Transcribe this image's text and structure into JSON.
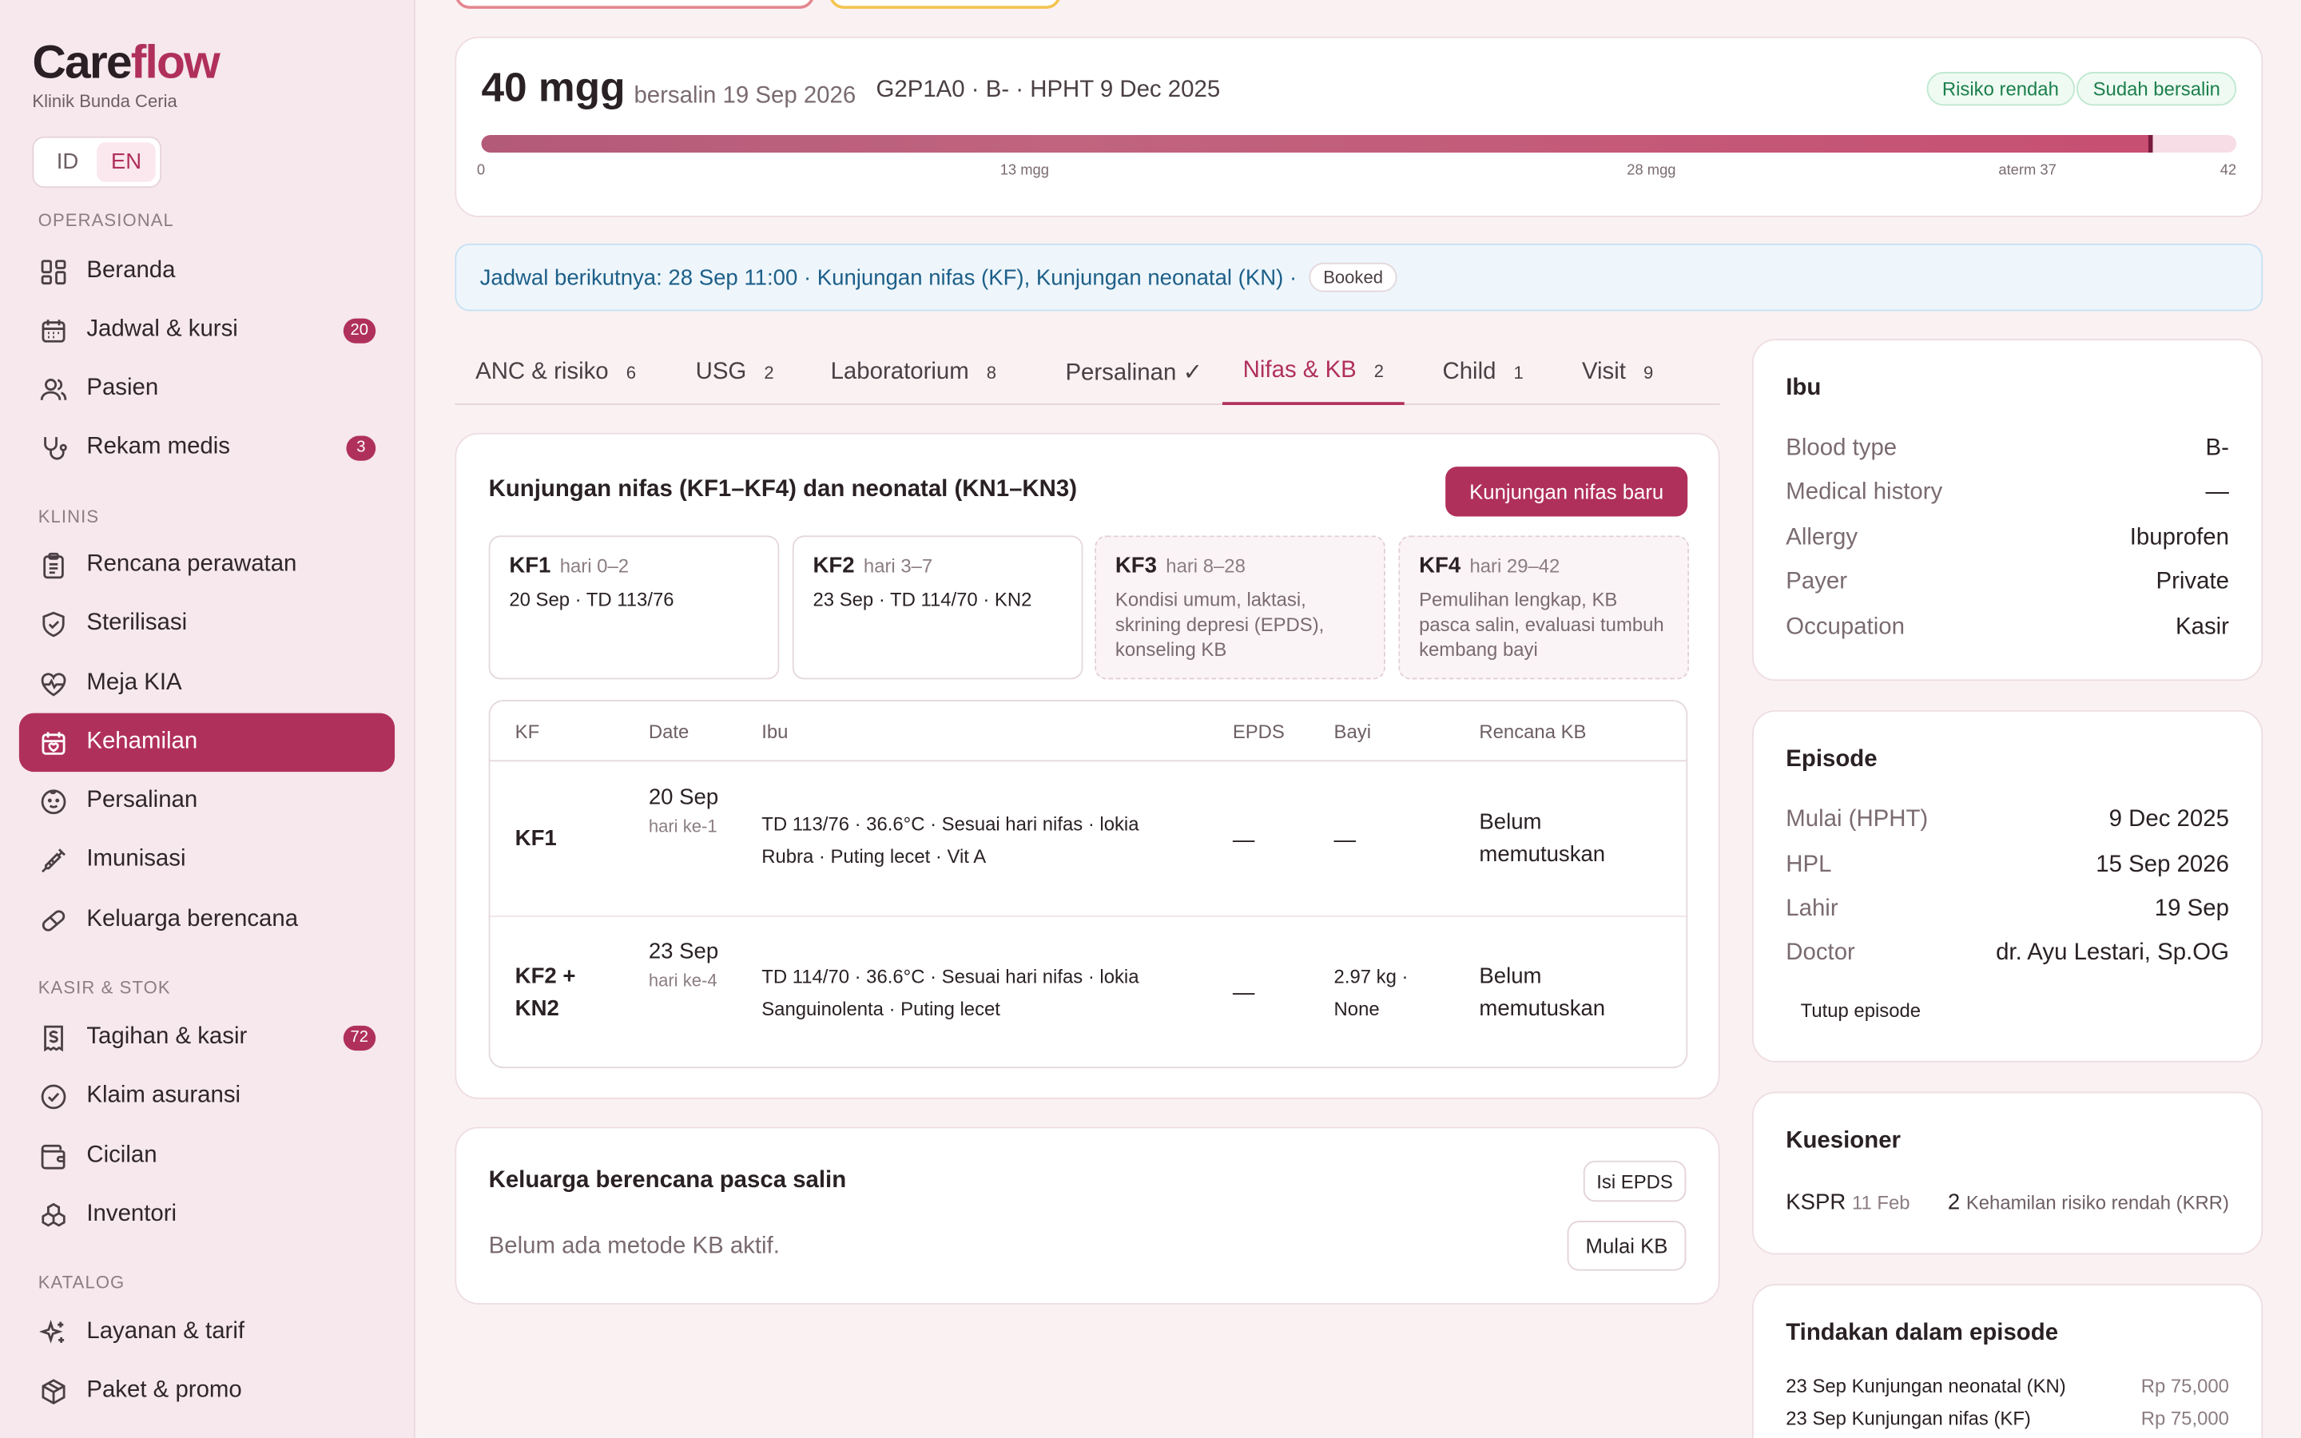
{
  "brand": {
    "name_main": "Care",
    "name_accent": "flow",
    "clinic": "Klinik Bunda Ceria"
  },
  "lang": {
    "id": "ID",
    "en": "EN"
  },
  "sidebar": {
    "sections": [
      {
        "label": "OPERASIONAL"
      },
      {
        "label": "KLINIS"
      },
      {
        "label": "KASIR & STOK"
      },
      {
        "label": "KATALOG"
      }
    ],
    "items": [
      {
        "label": "Beranda",
        "icon": "grid-icon"
      },
      {
        "label": "Jadwal & kursi",
        "icon": "calendar-icon",
        "badge": "20"
      },
      {
        "label": "Pasien",
        "icon": "users-icon"
      },
      {
        "label": "Rekam medis",
        "icon": "stethoscope-icon",
        "badge": "3"
      },
      {
        "label": "Rencana perawatan",
        "icon": "clipboard-icon"
      },
      {
        "label": "Sterilisasi",
        "icon": "shield-icon"
      },
      {
        "label": "Meja KIA",
        "icon": "heart-pulse-icon"
      },
      {
        "label": "Kehamilan",
        "icon": "calendar-heart-icon"
      },
      {
        "label": "Persalinan",
        "icon": "baby-icon"
      },
      {
        "label": "Imunisasi",
        "icon": "syringe-icon"
      },
      {
        "label": "Keluarga berencana",
        "icon": "pill-icon"
      },
      {
        "label": "Tagihan & kasir",
        "icon": "receipt-icon",
        "badge": "72"
      },
      {
        "label": "Klaim asuransi",
        "icon": "check-circle-icon"
      },
      {
        "label": "Cicilan",
        "icon": "wallet-icon"
      },
      {
        "label": "Inventori",
        "icon": "boxes-icon"
      },
      {
        "label": "Layanan & tarif",
        "icon": "sparkles-icon"
      },
      {
        "label": "Paket & promo",
        "icon": "package-icon"
      }
    ]
  },
  "pregnancy": {
    "weeks": "40 mgg",
    "born": "bersalin 19 Sep 2026",
    "code": "G2P1A0 · B- · HPHT 9 Dec 2025",
    "risk_pill": "Risiko rendah",
    "status_pill": "Sudah bersalin",
    "progress_weeks": 40,
    "progress_max": 42,
    "ticks": [
      {
        "label": "0",
        "week": 0
      },
      {
        "label": "13 mgg",
        "week": 13
      },
      {
        "label": "28 mgg",
        "week": 28
      },
      {
        "label": "aterm 37",
        "week": 37
      },
      {
        "label": "42",
        "week": 42
      }
    ]
  },
  "banner": {
    "text": "Jadwal berikutnya: 28 Sep 11:00 · Kunjungan nifas (KF), Kunjungan neonatal (KN) ·",
    "status": "Booked"
  },
  "tabs": [
    {
      "label": "ANC & risiko",
      "count": "6"
    },
    {
      "label": "USG",
      "count": "2"
    },
    {
      "label": "Laboratorium",
      "count": "8"
    },
    {
      "label": "Persalinan ✓",
      "count": ""
    },
    {
      "label": "Nifas & KB",
      "count": "2"
    },
    {
      "label": "Child",
      "count": "1"
    },
    {
      "label": "Visit",
      "count": "9"
    }
  ],
  "nifas": {
    "title": "Kunjungan nifas (KF1–KF4) dan neonatal (KN1–KN3)",
    "new_button": "Kunjungan nifas baru",
    "cards": [
      {
        "code": "KF1",
        "range": "hari 0–2",
        "body": "20 Sep · TD 113/76"
      },
      {
        "code": "KF2",
        "range": "hari 3–7",
        "body": "23 Sep · TD 114/70 · KN2"
      },
      {
        "code": "KF3",
        "range": "hari 8–28",
        "body": "Kondisi umum, laktasi, skrining depresi (EPDS), konseling KB"
      },
      {
        "code": "KF4",
        "range": "hari 29–42",
        "body": "Pemulihan lengkap, KB pasca salin, evaluasi tumbuh kembang bayi"
      }
    ],
    "columns": [
      "KF",
      "Date",
      "Ibu",
      "EPDS",
      "Bayi",
      "Rencana KB"
    ],
    "rows": [
      {
        "kf": "KF1",
        "date_main": "20 Sep",
        "date_sub": "hari ke-1",
        "ibu": "TD 113/76 · 36.6°C · Sesuai hari nifas · lokia Rubra · Puting lecet · Vit A",
        "epds": "—",
        "bayi": "—",
        "kb": "Belum memutuskan"
      },
      {
        "kf": "KF2 + KN2",
        "date_main": "23 Sep",
        "date_sub": "hari ke-4",
        "ibu": "TD 114/70 · 36.6°C · Sesuai hari nifas · lokia Sanguinolenta · Puting lecet",
        "epds": "—",
        "bayi": "2.97 kg · None",
        "kb": "Belum memutuskan"
      }
    ]
  },
  "kb": {
    "title": "Keluarga berencana pasca salin",
    "epds_button": "Isi EPDS",
    "empty": "Belum ada metode KB aktif.",
    "start_button": "Mulai KB"
  },
  "ibu": {
    "title": "Ibu",
    "rows": [
      {
        "label": "Blood type",
        "value": "B-"
      },
      {
        "label": "Medical history",
        "value": "—"
      },
      {
        "label": "Allergy",
        "value": "Ibuprofen"
      },
      {
        "label": "Payer",
        "value": "Private"
      },
      {
        "label": "Occupation",
        "value": "Kasir"
      }
    ]
  },
  "episode": {
    "title": "Episode",
    "rows": [
      {
        "label": "Mulai (HPHT)",
        "value": "9 Dec 2025"
      },
      {
        "label": "HPL",
        "value": "15 Sep 2026"
      },
      {
        "label": "Lahir",
        "value": "19 Sep"
      },
      {
        "label": "Doctor",
        "value": "dr. Ayu Lestari, Sp.OG"
      }
    ],
    "close": "Tutup episode"
  },
  "kuesioner": {
    "title": "Kuesioner",
    "name": "KSPR",
    "date": "11 Feb",
    "score": "2",
    "result": "Kehamilan risiko rendah (KRR)"
  },
  "tindakan": {
    "title": "Tindakan dalam episode",
    "items": [
      {
        "label": "23 Sep Kunjungan neonatal (KN)",
        "price": "Rp 75,000"
      },
      {
        "label": "23 Sep Kunjungan nifas (KF)",
        "price": "Rp 75,000"
      }
    ]
  },
  "colors": {
    "accent": "#b0305c",
    "success": "#1c7f4c",
    "info": "#1d5f88"
  }
}
